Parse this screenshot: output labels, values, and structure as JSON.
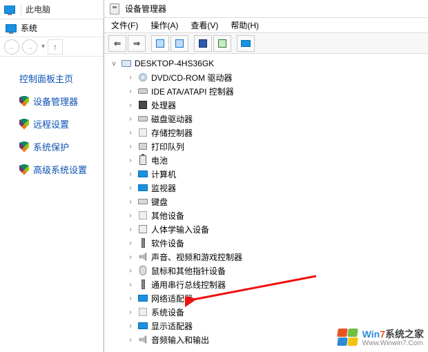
{
  "topbar": {
    "crumb": "此电脑"
  },
  "left": {
    "system_label": "系统",
    "main_link": "控制面板主页",
    "shield_links": [
      "设备管理器",
      "远程设置",
      "系统保护",
      "高级系统设置"
    ]
  },
  "dm": {
    "title": "设备管理器",
    "menu": {
      "file": "文件(F)",
      "action": "操作(A)",
      "view": "查看(V)",
      "help": "帮助(H)"
    },
    "root": "DESKTOP-4HS36GK",
    "nodes": [
      {
        "icon": "dvd",
        "label": "DVD/CD-ROM 驱动器"
      },
      {
        "icon": "disk",
        "label": "IDE ATA/ATAPI 控制器"
      },
      {
        "icon": "chip",
        "label": "处理器"
      },
      {
        "icon": "disk",
        "label": "磁盘驱动器"
      },
      {
        "icon": "gen",
        "label": "存储控制器"
      },
      {
        "icon": "pr",
        "label": "打印队列"
      },
      {
        "icon": "batt",
        "label": "电池"
      },
      {
        "icon": "mon",
        "label": "计算机"
      },
      {
        "icon": "mon",
        "label": "监视器"
      },
      {
        "icon": "kb",
        "label": "键盘"
      },
      {
        "icon": "gen",
        "label": "其他设备"
      },
      {
        "icon": "hid",
        "label": "人体学输入设备"
      },
      {
        "icon": "usb",
        "label": "软件设备"
      },
      {
        "icon": "sp",
        "label": "声音、视频和游戏控制器"
      },
      {
        "icon": "ms",
        "label": "鼠标和其他指针设备"
      },
      {
        "icon": "usb",
        "label": "通用串行总线控制器"
      },
      {
        "icon": "mon",
        "label": "网络适配器"
      },
      {
        "icon": "gen",
        "label": "系统设备"
      },
      {
        "icon": "mon",
        "label": "显示适配器"
      },
      {
        "icon": "sp",
        "label": "音频输入和输出"
      }
    ]
  },
  "watermark": {
    "brand_prefix": "Win",
    "brand_num": "7",
    "brand_suffix": "系统之家",
    "url": "Www.Winwin7.Com"
  }
}
